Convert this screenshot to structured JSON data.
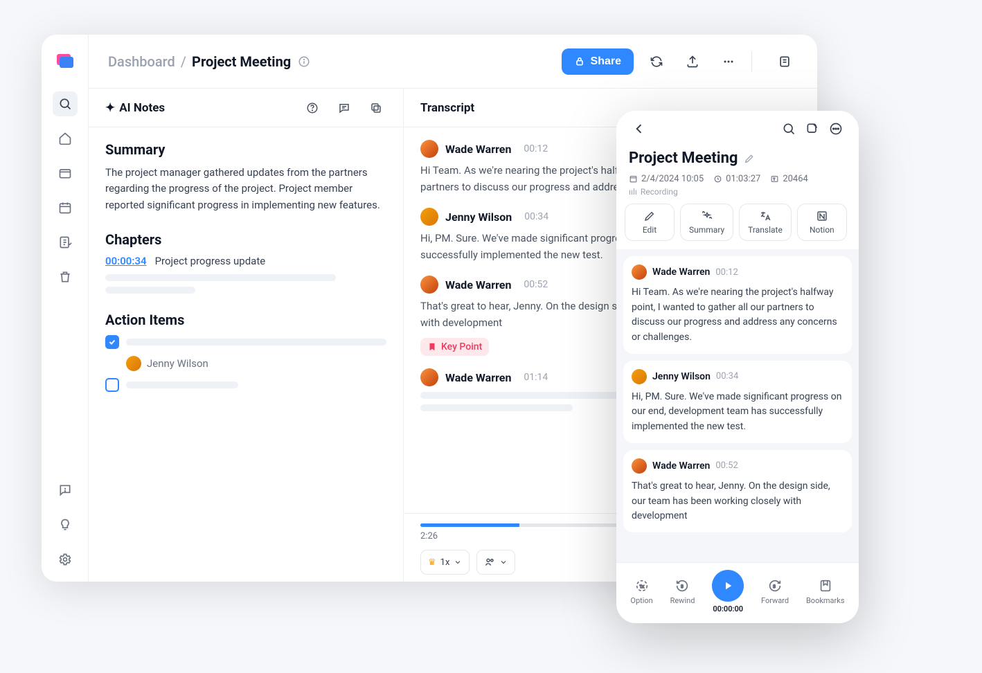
{
  "breadcrumb": {
    "root": "Dashboard",
    "title": "Project Meeting"
  },
  "topbar": {
    "share_label": "Share"
  },
  "ai_notes": {
    "heading": "AI Notes",
    "summary": {
      "heading": "Summary",
      "text": "The project manager gathered updates from the partners regarding the progress of the project. Project member reported significant progress in implementing new features."
    },
    "chapters": {
      "heading": "Chapters",
      "items": [
        {
          "time": "00:00:34",
          "title": "Project progress update"
        }
      ]
    },
    "action_items": {
      "heading": "Action Items",
      "items": [
        {
          "checked": true,
          "assignee": "Jenny Wilson"
        },
        {
          "checked": false
        }
      ]
    }
  },
  "transcript": {
    "heading": "Transcript",
    "turns": [
      {
        "speaker": "Wade Warren",
        "ts": "00:12",
        "text": "Hi Team. As we're nearing the project's halfway point, I wanted to gather all our partners to discuss our progress and address any concerns or challenges."
      },
      {
        "speaker": "Jenny Wilson",
        "ts": "00:34",
        "text": "Hi, PM. Sure. We've made significant progress on our end, development team has successfully implemented the new test."
      },
      {
        "speaker": "Wade Warren",
        "ts": "00:52",
        "text": "That's great to hear, Jenny. On the design side, our team has been working closely with development",
        "keypoint": "Key Point"
      },
      {
        "speaker": "Wade Warren",
        "ts": "01:14",
        "text": ""
      }
    ],
    "player": {
      "time": "2:26",
      "speed": "1x"
    }
  },
  "mobile": {
    "title": "Project Meeting",
    "meta": {
      "date": "2/4/2024 10:05",
      "duration": "01:03:27",
      "words": "20464",
      "status": "Recording"
    },
    "actions": [
      {
        "label": "Edit"
      },
      {
        "label": "Summary"
      },
      {
        "label": "Translate"
      },
      {
        "label": "Notion"
      }
    ],
    "turns": [
      {
        "speaker": "Wade Warren",
        "ts": "00:12",
        "text": "Hi Team. As we're nearing the project's halfway point, I wanted to gather all our partners to discuss our progress and address any concerns or challenges."
      },
      {
        "speaker": "Jenny Wilson",
        "ts": "00:34",
        "text": "Hi, PM. Sure. We've made significant progress on our end, development team has successfully implemented the new test."
      },
      {
        "speaker": "Wade Warren",
        "ts": "00:52",
        "text": "That's great to hear, Jenny. On the design side, our team has been working closely with development"
      }
    ],
    "player": {
      "option": "Option",
      "rewind": "Rewind",
      "time": "00:00:00",
      "forward": "Forward",
      "bookmarks": "Bookmarks"
    }
  }
}
